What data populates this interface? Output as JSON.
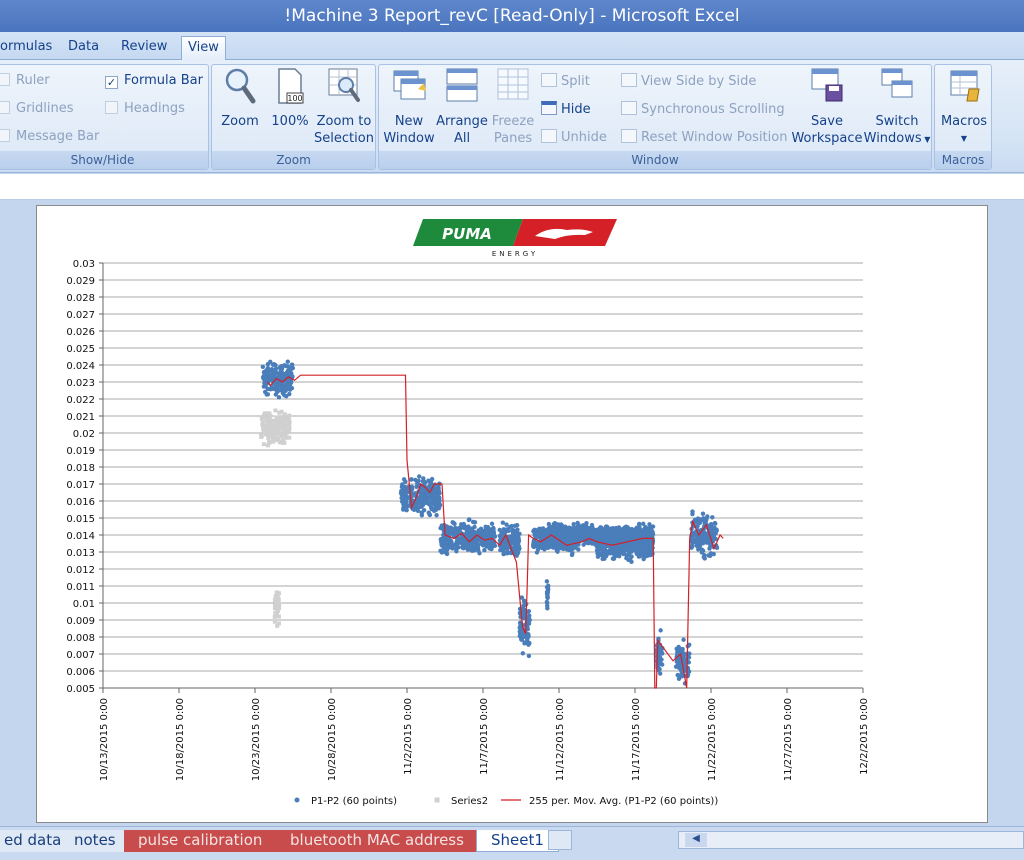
{
  "window": {
    "title": "!Machine 3 Report_revC  [Read-Only] - Microsoft Excel"
  },
  "tabs": [
    {
      "label": "ormulas"
    },
    {
      "label": "Data"
    },
    {
      "label": "Review"
    },
    {
      "label": "View"
    }
  ],
  "ribbon": {
    "showhide": {
      "caption": "Show/Hide",
      "ruler": "Ruler",
      "gridlines": "Gridlines",
      "message_bar": "Message Bar",
      "formula_bar": "Formula Bar",
      "headings": "Headings"
    },
    "zoom": {
      "caption": "Zoom",
      "zoom": "Zoom",
      "hundred": "100%",
      "hundred_icon_label": "100",
      "zoom_to_selection_1": "Zoom to",
      "zoom_to_selection_2": "Selection"
    },
    "window": {
      "caption": "Window",
      "new_window_1": "New",
      "new_window_2": "Window",
      "arrange_all_1": "Arrange",
      "arrange_all_2": "All",
      "freeze_panes_1": "Freeze",
      "freeze_panes_2": "Panes",
      "split": "Split",
      "hide": "Hide",
      "unhide": "Unhide",
      "view_side_by_side": "View Side by Side",
      "synchronous_scrolling": "Synchronous Scrolling",
      "reset_window_position": "Reset Window Position",
      "save_workspace_1": "Save",
      "save_workspace_2": "Workspace",
      "switch_windows_1": "Switch",
      "switch_windows_2": "Windows"
    },
    "macros": {
      "caption": "Macros",
      "label": "Macros"
    }
  },
  "logo": {
    "text": "PUMA",
    "sub": "ENERGY",
    "green": "#1e8a3c",
    "red": "#d42026"
  },
  "chart_data": {
    "type": "scatter",
    "yticks": [
      "0.03",
      "0.029",
      "0.028",
      "0.027",
      "0.026",
      "0.025",
      "0.024",
      "0.023",
      "0.022",
      "0.021",
      "0.02",
      "0.019",
      "0.018",
      "0.017",
      "0.016",
      "0.015",
      "0.014",
      "0.013",
      "0.012",
      "0.011",
      "0.01",
      "0.009",
      "0.008",
      "0.007",
      "0.006",
      "0.005"
    ],
    "ylim": [
      0.005,
      0.03
    ],
    "xticks": [
      "10/13/2015  0:00",
      "10/18/2015  0:00",
      "10/23/2015  0:00",
      "10/28/2015  0:00",
      "11/2/2015  0:00",
      "11/7/2015  0:00",
      "11/12/2015  0:00",
      "11/17/2015  0:00",
      "11/22/2015  0:00",
      "11/27/2015  0:00",
      "12/2/2015  0:00"
    ],
    "xlim_days": [
      0,
      50
    ],
    "series": [
      {
        "name": "P1-P2 (60 points)",
        "color": "#4a7ebb",
        "clusters": [
          {
            "x": [
              10.5,
              12.5
            ],
            "y": 0.0232,
            "spread": 0.0008
          },
          {
            "x": [
              19.6,
              22.2
            ],
            "y": 0.0162,
            "spread": 0.0009
          },
          {
            "x": [
              22.2,
              25.8
            ],
            "y": 0.0138,
            "spread": 0.0008
          },
          {
            "x": [
              26.1,
              27.4
            ],
            "y": 0.0137,
            "spread": 0.0009
          },
          {
            "x": [
              27.4,
              28.1
            ],
            "y": 0.0086,
            "spread": 0.0015
          },
          {
            "x": [
              28.3,
              31.3
            ],
            "y": 0.0138,
            "spread": 0.0007
          },
          {
            "x": [
              32.5,
              36.2
            ],
            "y": 0.0134,
            "spread": 0.0007
          },
          {
            "x": [
              29.5,
              36.2
            ],
            "y": 0.014,
            "spread": 0.0005
          },
          {
            "x": [
              29.0,
              31.0
            ],
            "y": 0.0138,
            "spread": 0.0006
          },
          {
            "x": [
              29.2,
              29.3
            ],
            "y": 0.0105,
            "spread": 0.0009
          },
          {
            "x": [
              36.4,
              36.8
            ],
            "y": 0.007,
            "spread": 0.001
          },
          {
            "x": [
              37.7,
              38.6
            ],
            "y": 0.0065,
            "spread": 0.0011
          },
          {
            "x": [
              38.7,
              40.4
            ],
            "y": 0.014,
            "spread": 0.001
          }
        ]
      },
      {
        "name": "Series2",
        "color": "#d0d0d0",
        "clusters": [
          {
            "x": [
              10.4,
              12.3
            ],
            "y": 0.0203,
            "spread": 0.0008
          },
          {
            "x": [
              11.3,
              11.6
            ],
            "y": 0.01,
            "spread": 0.001
          }
        ]
      },
      {
        "name": "255 per. Mov. Avg. (P1-P2 (60 points))",
        "color": "#d42026",
        "x": [
          10.8,
          11.0,
          11.4,
          11.8,
          12.2,
          12.6,
          13.0,
          13.5,
          19.9,
          20.0,
          20.3,
          20.6,
          20.9,
          21.2,
          21.5,
          21.8,
          22.1,
          22.3,
          22.5,
          23.1,
          23.6,
          24.1,
          24.6,
          25.1,
          25.6,
          26.1,
          26.5,
          27.2,
          27.6,
          27.8,
          27.9,
          28.0,
          28.3,
          28.8,
          29.5,
          30.5,
          31.5,
          32.0,
          32.5,
          33.5,
          34.5,
          35.5,
          36.2,
          36.3,
          36.4,
          36.5,
          37.5,
          38.0,
          38.4,
          38.6,
          38.8,
          39.2,
          39.7,
          40.2,
          40.6,
          40.8
        ],
        "y": [
          0.023,
          0.0228,
          0.0232,
          0.023,
          0.0233,
          0.0231,
          0.0234,
          0.0234,
          0.0234,
          0.0184,
          0.0156,
          0.0162,
          0.017,
          0.0168,
          0.0165,
          0.017,
          0.017,
          0.017,
          0.014,
          0.0138,
          0.0141,
          0.0136,
          0.014,
          0.0137,
          0.0138,
          0.0134,
          0.014,
          0.0124,
          0.0086,
          0.0082,
          0.0108,
          0.014,
          0.0138,
          0.0136,
          0.014,
          0.0134,
          0.0136,
          0.0138,
          0.0136,
          0.0134,
          0.0136,
          0.0138,
          0.0138,
          0.005,
          0.005,
          0.0078,
          0.0066,
          0.007,
          0.005,
          0.0138,
          0.0148,
          0.014,
          0.0146,
          0.0132,
          0.014,
          0.0138
        ]
      }
    ],
    "legend": [
      {
        "label": "P1-P2 (60 points)"
      },
      {
        "label": "Series2"
      },
      {
        "label": "255 per. Mov. Avg. (P1-P2 (60 points))"
      }
    ],
    "legend_position": "bottom",
    "grid": true
  },
  "sheet_tabs": [
    {
      "label": "ed data"
    },
    {
      "label": "notes"
    },
    {
      "label": "pulse calibration"
    },
    {
      "label": "bluetooth MAC address"
    },
    {
      "label": "Sheet1"
    }
  ]
}
